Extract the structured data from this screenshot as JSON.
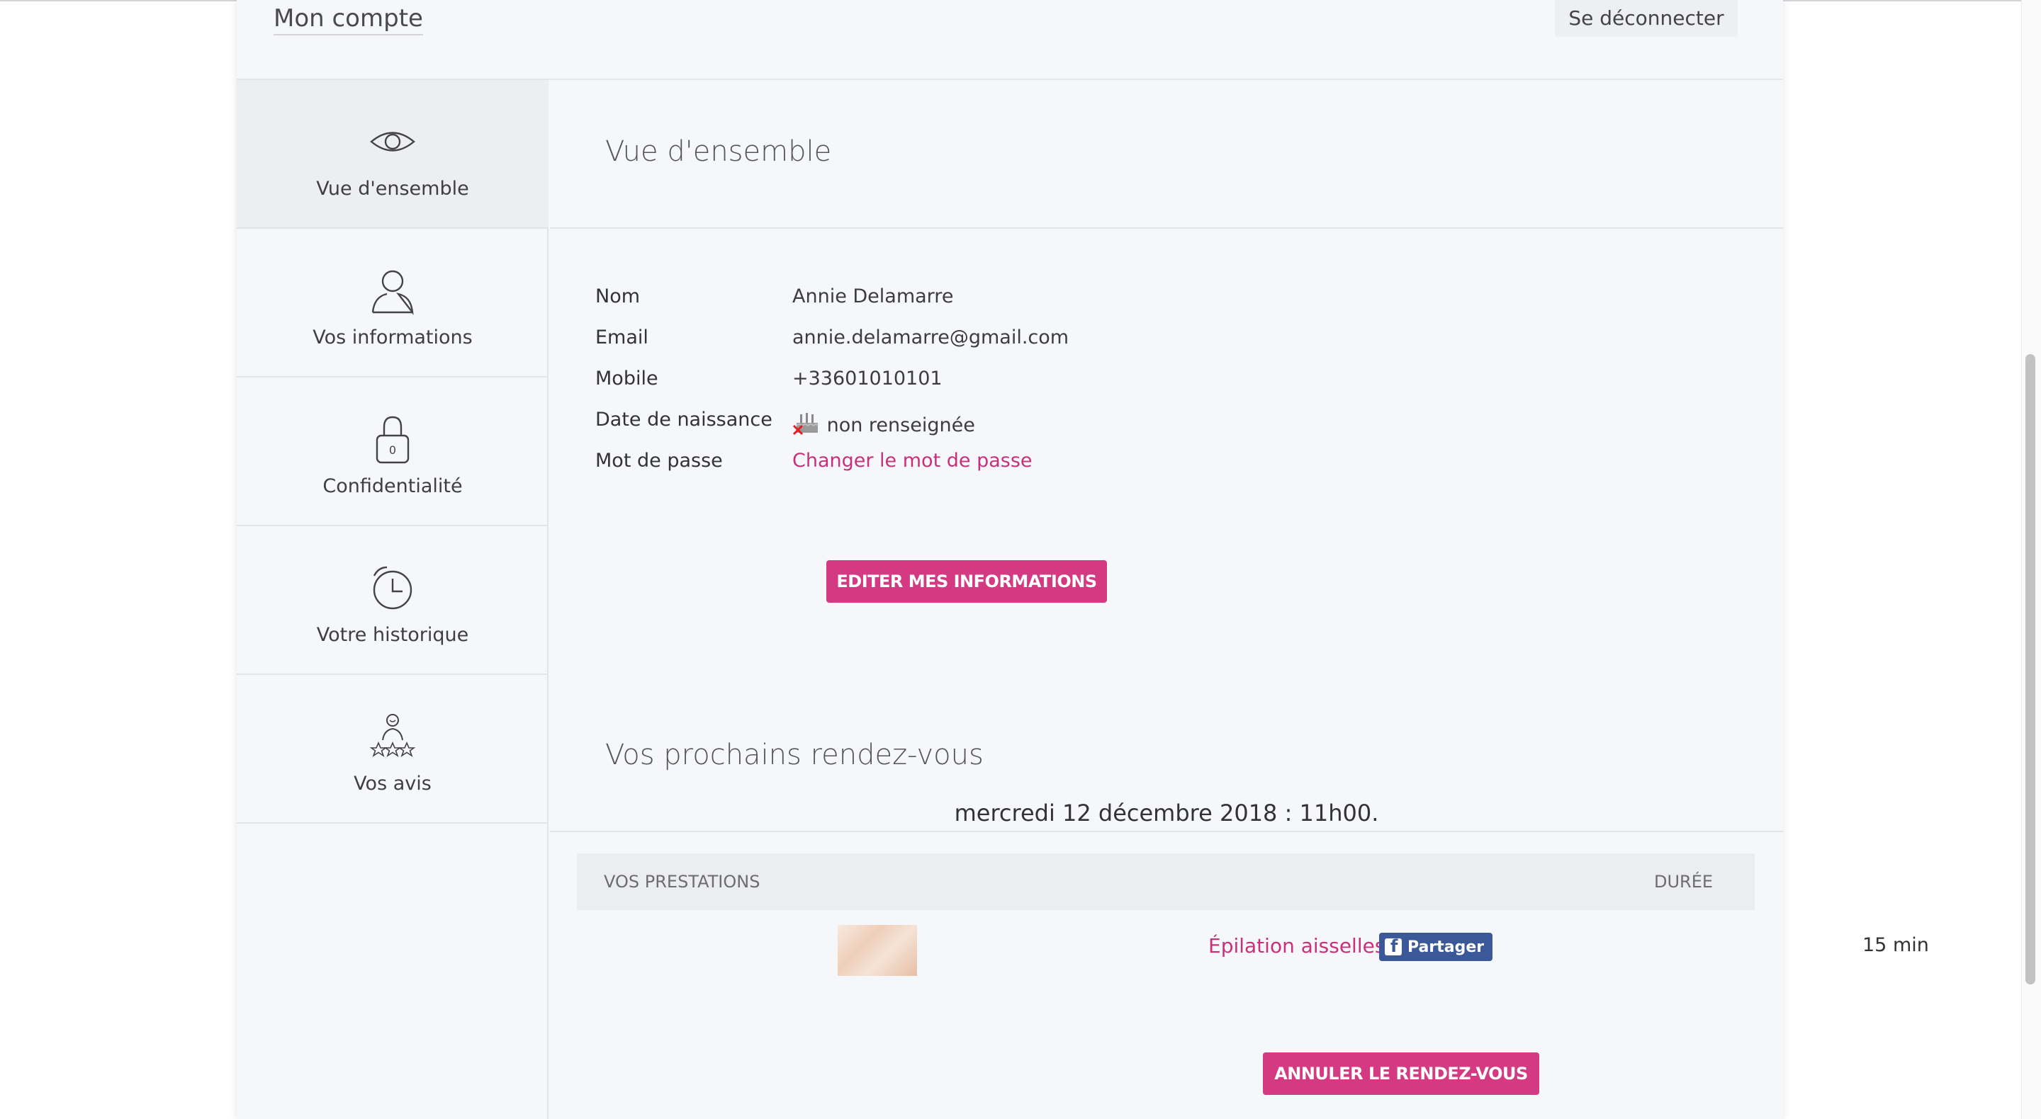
{
  "header": {
    "title": "Mon compte",
    "logout_label": "Se déconnecter"
  },
  "sidebar": {
    "items": [
      {
        "label": "Vue d'ensemble",
        "icon": "eye-icon",
        "active": true
      },
      {
        "label": "Vos informations",
        "icon": "user-icon",
        "active": false
      },
      {
        "label": "Confidentialité",
        "icon": "lock-icon",
        "lock_digit": "0",
        "active": false
      },
      {
        "label": "Votre historique",
        "icon": "clock-icon",
        "active": false
      },
      {
        "label": "Vos avis",
        "icon": "rating-icon",
        "active": false
      }
    ]
  },
  "overview": {
    "title": "Vue d'ensemble",
    "fields": {
      "name_label": "Nom",
      "name_value": "Annie Delamarre",
      "email_label": "Email",
      "email_value": "annie.delamarre@gmail.com",
      "mobile_label": "Mobile",
      "mobile_value": "+33601010101",
      "birth_label": "Date de naissance",
      "birth_value": "non renseignée",
      "password_label": "Mot de passe",
      "password_link": "Changer le mot de passe"
    },
    "edit_button": "EDITER MES INFORMATIONS"
  },
  "appointments": {
    "title": "Vos prochains rendez-vous",
    "date": "mercredi 12 décembre 2018 : 11h00.",
    "table": {
      "col_services": "VOS PRESTATIONS",
      "col_duration": "DURÉE",
      "rows": [
        {
          "service": "Épilation aisselles",
          "share": "Partager",
          "duration": "15 min"
        }
      ]
    },
    "cancel_button": "ANNULER LE RENDEZ-VOUS"
  },
  "colors": {
    "accent": "#d33a81",
    "link": "#c8307a",
    "facebook": "#3b5998",
    "panel_bg": "#f6f7fb"
  }
}
